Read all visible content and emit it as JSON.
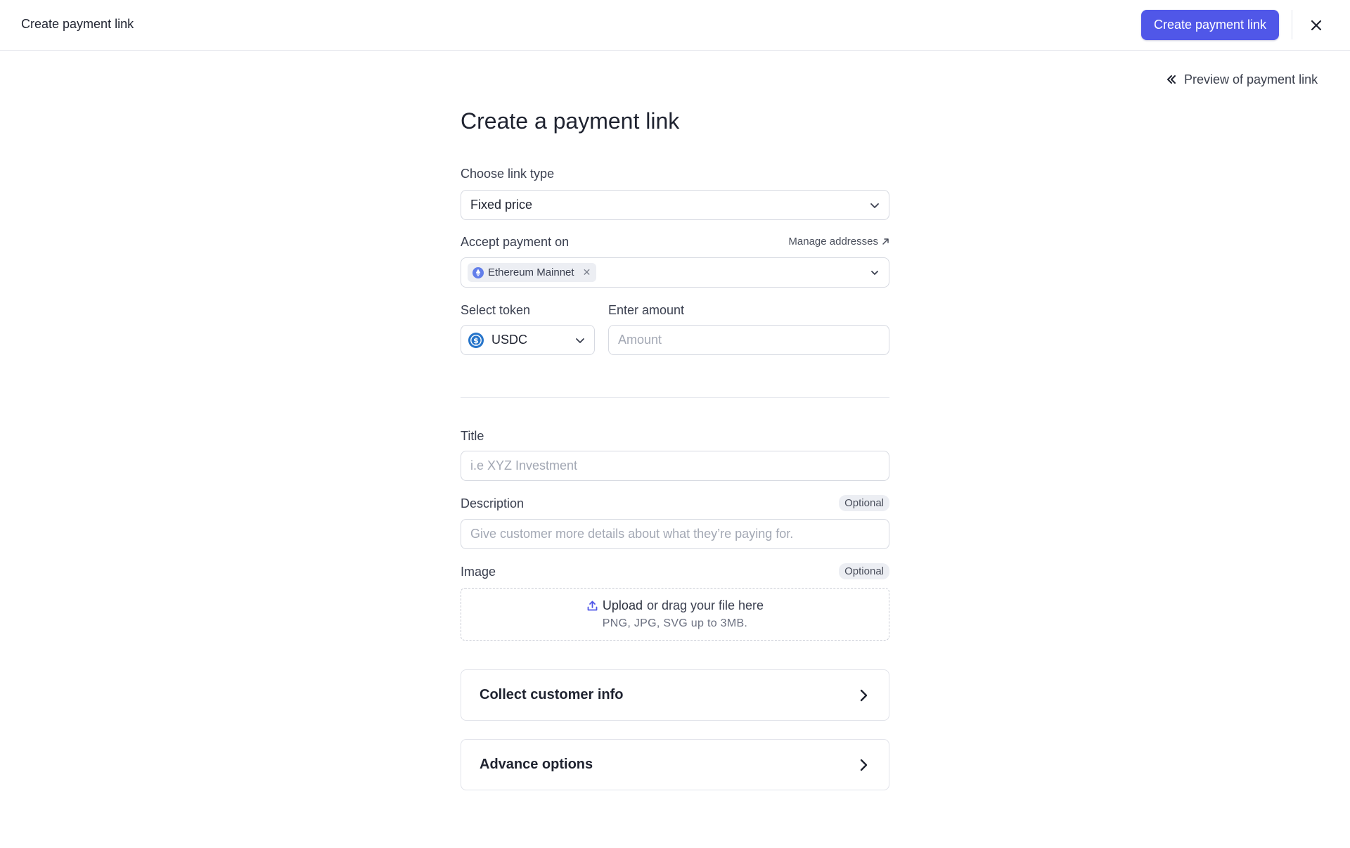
{
  "header": {
    "title": "Create payment link",
    "create_button": "Create payment link"
  },
  "preview": {
    "label": "Preview of payment link"
  },
  "form": {
    "page_title": "Create a payment link",
    "link_type": {
      "label": "Choose link type",
      "value": "Fixed price"
    },
    "accept_payment": {
      "label": "Accept payment on",
      "manage_label": "Manage addresses",
      "chips": [
        "Ethereum Mainnet"
      ]
    },
    "token": {
      "label": "Select token",
      "value": "USDC"
    },
    "amount": {
      "label": "Enter amount",
      "placeholder": "Amount"
    },
    "title_field": {
      "label": "Title",
      "placeholder": "i.e XYZ Investment"
    },
    "description": {
      "label": "Description",
      "badge": "Optional",
      "placeholder": "Give customer more details about what they’re paying for."
    },
    "image": {
      "label": "Image",
      "badge": "Optional",
      "upload_label": "Upload",
      "drag_label": "or drag your file here",
      "hint": "PNG, JPG, SVG up to 3MB."
    },
    "sections": [
      {
        "label": "Collect customer info"
      },
      {
        "label": "Advance options"
      }
    ]
  },
  "colors": {
    "primary": "#5057e8",
    "border": "#d6d9e1",
    "text": "#1f2330",
    "muted": "#a3a8b4",
    "usdc_blue": "#2775ca",
    "eth_blue": "#627eea"
  }
}
